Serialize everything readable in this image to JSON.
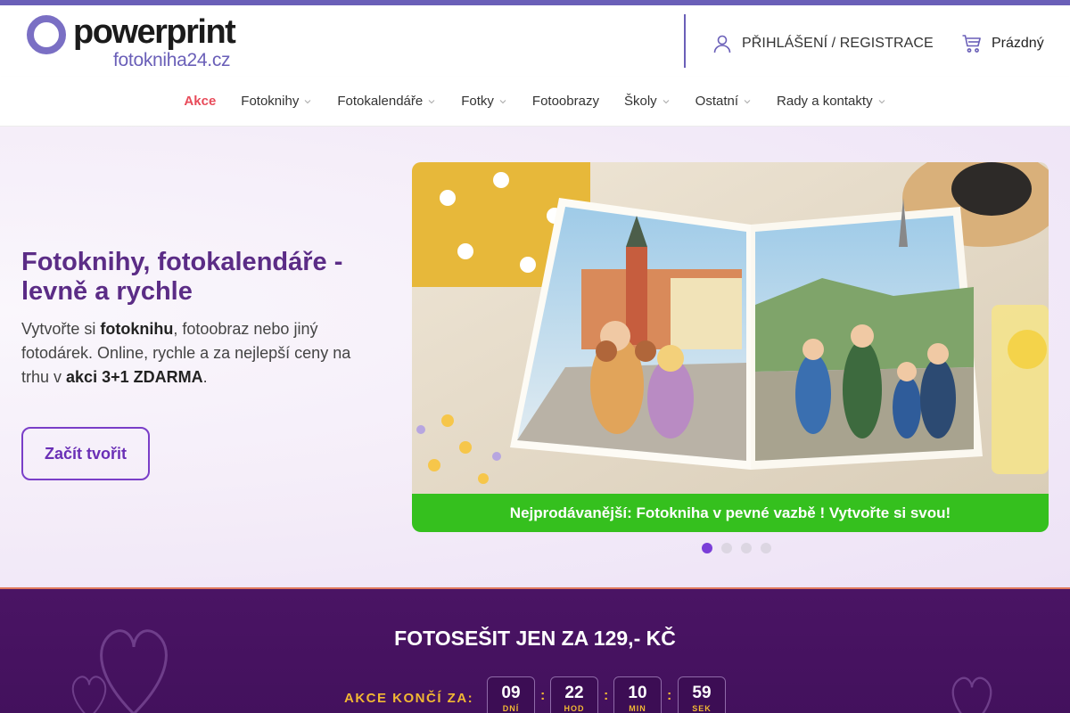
{
  "brand": {
    "name": "powerprint",
    "domain": "fotokniha24.cz",
    "accent": "#6a5fb8"
  },
  "header": {
    "login_label": "PŘIHLÁŠENÍ / REGISTRACE",
    "login_icon": "user-icon",
    "cart_label": "Prázdný",
    "cart_icon": "cart-icon"
  },
  "nav": {
    "items": [
      {
        "label": "Akce",
        "dropdown": false
      },
      {
        "label": "Fotoknihy",
        "dropdown": true
      },
      {
        "label": "Fotokalendáře",
        "dropdown": true
      },
      {
        "label": "Fotky",
        "dropdown": true
      },
      {
        "label": "Fotoobrazy",
        "dropdown": false
      },
      {
        "label": "Školy",
        "dropdown": true
      },
      {
        "label": "Ostatní",
        "dropdown": true
      },
      {
        "label": "Rady a kontakty",
        "dropdown": true
      }
    ]
  },
  "hero": {
    "title": "Fotoknihy, fotokalendáře - levně a rychle",
    "text_1": "Vytvořte si ",
    "text_bold_1": "fotoknihu",
    "text_2": ", fotoobraz nebo jiný fotodárek. Online, rychle a za nejlepší ceny na trhu v ",
    "text_bold_2": "akci 3+1 ZDARMA",
    "text_3": ".",
    "cta_label": "Začít tvořit",
    "slide_caption": "Nejprodávanější: Fotokniha v pevné vazbě ! Vytvořte si svou!",
    "slide_caption_color": "#35c01e",
    "slide_count": 4,
    "active_slide": 1
  },
  "promo": {
    "title": "FOTOSEŠIT JEN ZA 129,- KČ",
    "ends_label": "AKCE KONČÍ ZA:",
    "countdown": [
      {
        "value": "09",
        "unit": "DNÍ"
      },
      {
        "value": "22",
        "unit": "HOD"
      },
      {
        "value": "10",
        "unit": "MIN"
      },
      {
        "value": "59",
        "unit": "SEK"
      }
    ],
    "separator": ":",
    "bg_color": "#4a1464",
    "label_color": "#f2b833"
  }
}
